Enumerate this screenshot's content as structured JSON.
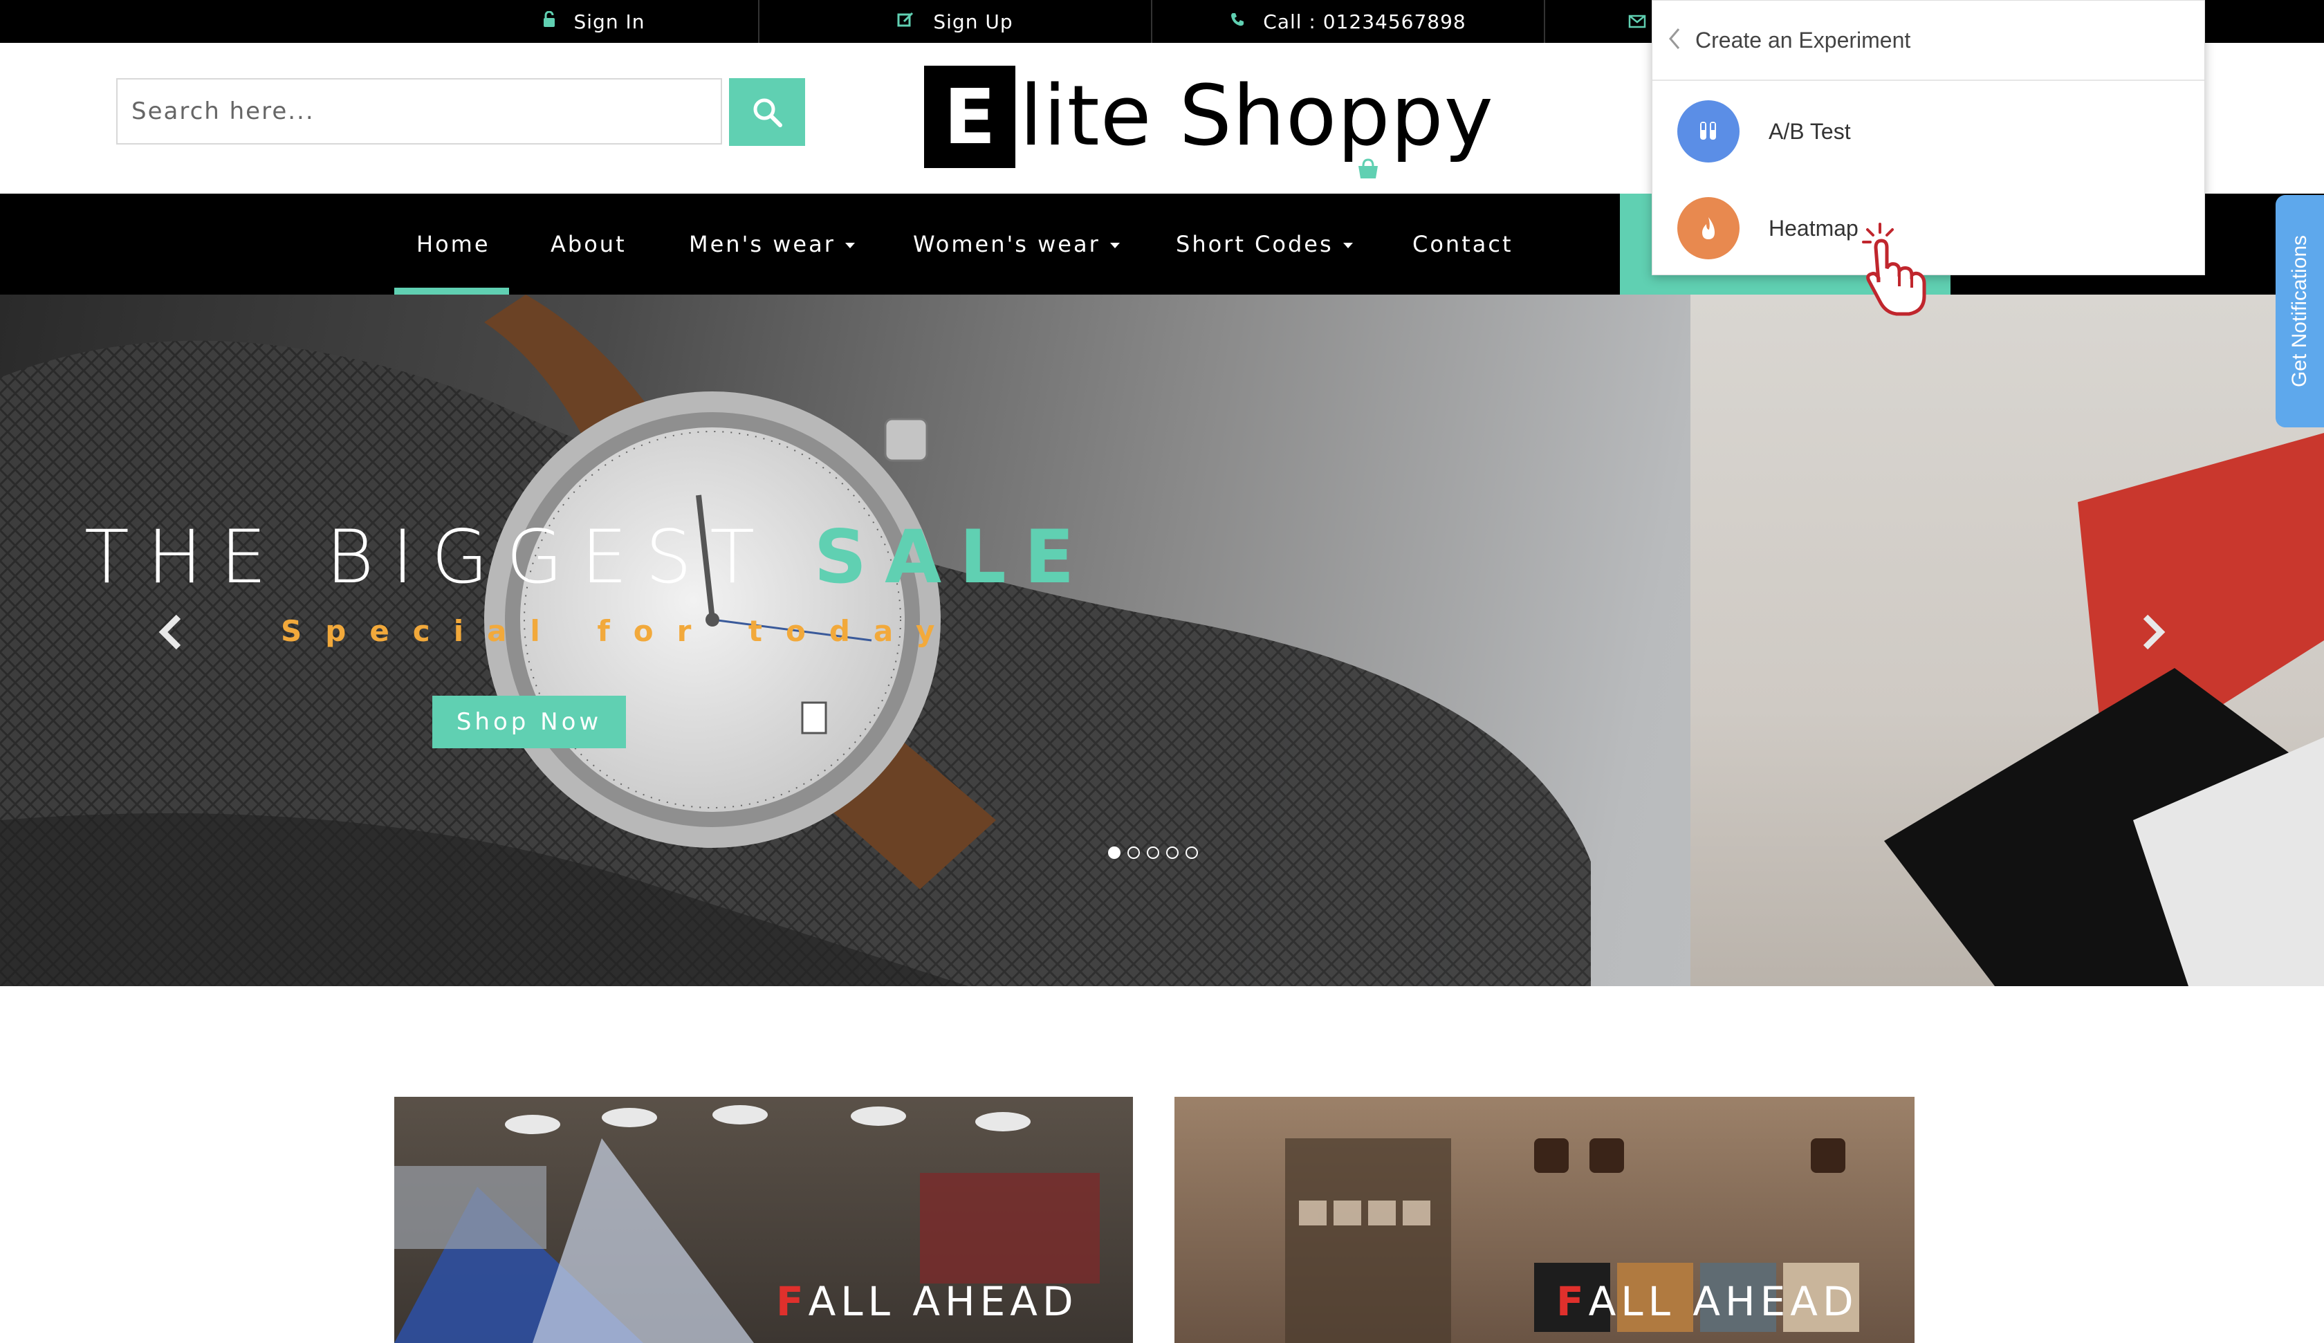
{
  "topbar": {
    "sign_in": "Sign In",
    "sign_up": "Sign Up",
    "call": "Call : 01234567898"
  },
  "search": {
    "placeholder": "Search here..."
  },
  "logo": {
    "letter": "E",
    "rest": "lite Shoppy"
  },
  "nav": {
    "items": [
      "Home",
      "About",
      "Men's wear",
      "Women's wear",
      "Short Codes",
      "Contact"
    ],
    "active": "Home"
  },
  "hero": {
    "title_main": "THE BIGGEST ",
    "title_accent": "SALE",
    "subtitle": "Special for today",
    "button": "Shop Now",
    "slides": 5,
    "active_slide": 1
  },
  "banners": [
    {
      "first": "F",
      "rest": "ALL AHEAD"
    },
    {
      "first": "F",
      "rest": "ALL AHEAD"
    }
  ],
  "panel": {
    "title": "Create an Experiment",
    "items": [
      {
        "label": "A/B Test",
        "icon": "test-tubes-icon",
        "color": "#5b8ee6"
      },
      {
        "label": "Heatmap",
        "icon": "flame-icon",
        "color": "#e8894f"
      }
    ]
  },
  "side_tab": {
    "label": "Get Notifications"
  },
  "colors": {
    "accent": "#60d0b2",
    "subtitle": "#f2a93b",
    "fall_red": "#e0302c",
    "tab_blue": "#5ea8ec"
  }
}
